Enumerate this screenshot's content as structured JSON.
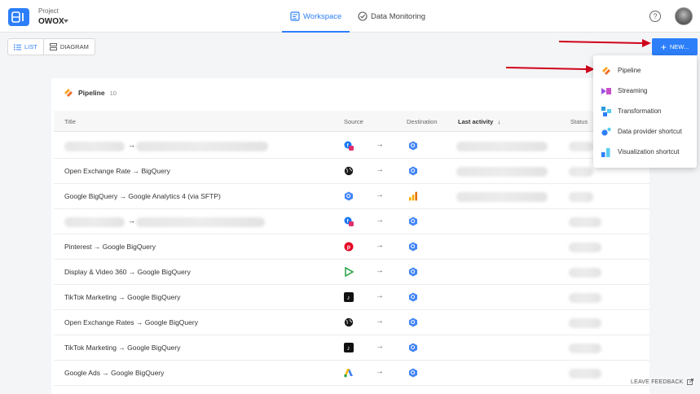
{
  "header": {
    "project_label": "Project",
    "project_name": "OWOX",
    "tabs": [
      {
        "label": "Workspace",
        "icon": "workspace-icon",
        "active": true
      },
      {
        "label": "Data Monitoring",
        "icon": "monitoring-icon",
        "active": false
      }
    ],
    "help_icon": "help-icon",
    "avatar_icon": "user-avatar"
  },
  "toolbar": {
    "view_list_label": "LIST",
    "view_diagram_label": "DIAGRAM",
    "new_label": "NEW..."
  },
  "card": {
    "title": "Pipeline",
    "count": "10",
    "columns": {
      "title": "Title",
      "source": "Source",
      "destination": "Destination",
      "last_activity": "Last activity",
      "status": "Status"
    },
    "arrow_glyph": "→",
    "rows": [
      {
        "title": "",
        "arrow_text": "→",
        "source": "facebook-instagram",
        "destination": "bigquery"
      },
      {
        "title": "Open Exchange Rate → BigQuery",
        "arrow_text": "",
        "source": "globe",
        "destination": "bigquery"
      },
      {
        "title": "Google BigQuery → Google Analytics 4 (via SFTP)",
        "arrow_text": "",
        "source": "bigquery",
        "destination": "google-analytics"
      },
      {
        "title": "",
        "arrow_text": "→",
        "source": "facebook-instagram",
        "destination": "bigquery"
      },
      {
        "title": "Pinterest → Google BigQuery",
        "arrow_text": "",
        "source": "pinterest",
        "destination": "bigquery"
      },
      {
        "title": "Display & Video 360 → Google BigQuery",
        "arrow_text": "",
        "source": "dv360",
        "destination": "bigquery"
      },
      {
        "title": "TikTok Marketing → Google BigQuery",
        "arrow_text": "",
        "source": "tiktok",
        "destination": "bigquery"
      },
      {
        "title": "Open Exchange Rates → Google BigQuery",
        "arrow_text": "",
        "source": "globe",
        "destination": "bigquery"
      },
      {
        "title": "TikTok Marketing → Google BigQuery",
        "arrow_text": "",
        "source": "tiktok",
        "destination": "bigquery"
      },
      {
        "title": "Google Ads → Google BigQuery",
        "arrow_text": "",
        "source": "google-ads",
        "destination": "bigquery"
      }
    ]
  },
  "menu": {
    "items": [
      {
        "label": "Pipeline",
        "icon": "pipeline-icon"
      },
      {
        "label": "Streaming",
        "icon": "streaming-icon"
      },
      {
        "label": "Transformation",
        "icon": "transformation-icon"
      },
      {
        "label": "Data provider shortcut",
        "icon": "data-provider-icon"
      },
      {
        "label": "Visualization shortcut",
        "icon": "visualization-icon"
      }
    ]
  },
  "footer": {
    "feedback_label": "LEAVE FEEDBACK"
  },
  "colors": {
    "accent": "#2d7ff9",
    "annotation_arrow": "#d0021b"
  }
}
